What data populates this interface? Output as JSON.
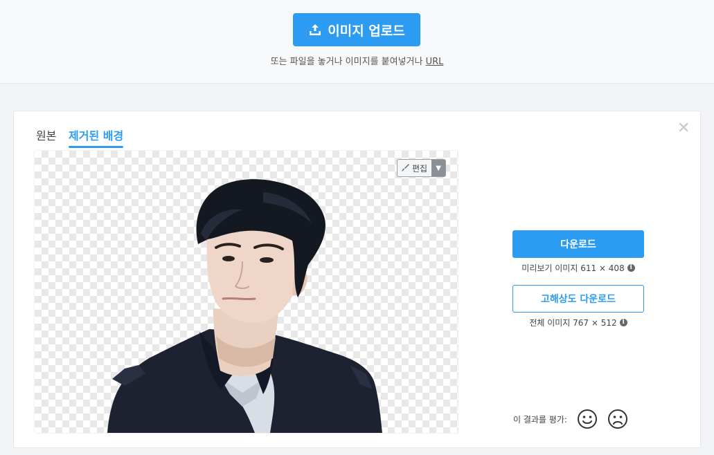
{
  "header": {
    "upload_label": "이미지 업로드",
    "hint_text": "또는 파일을 놓거나 이미지를 붙여넣거나 ",
    "hint_link": "URL"
  },
  "result": {
    "close_symbol": "✕",
    "tabs": [
      {
        "label": "원본",
        "active": false
      },
      {
        "label": "제거된 배경",
        "active": true
      }
    ],
    "edit_label": "편집",
    "download_label": "다운로드",
    "preview_info": "미리보기 이미지 611 × 408",
    "hd_download_label": "고해상도 다운로드",
    "full_info": "전체 이미지 767 × 512",
    "rate_label": "이 결과를 평가:"
  },
  "icons": {
    "upload": "upload-icon",
    "brush": "brush-icon",
    "caret": "caret-down-icon",
    "info": "info-icon",
    "happy": "smile-face-icon",
    "sad": "sad-face-icon",
    "close": "close-icon"
  },
  "colors": {
    "accent": "#2b9cf2",
    "checker": "#e8e8e8"
  }
}
